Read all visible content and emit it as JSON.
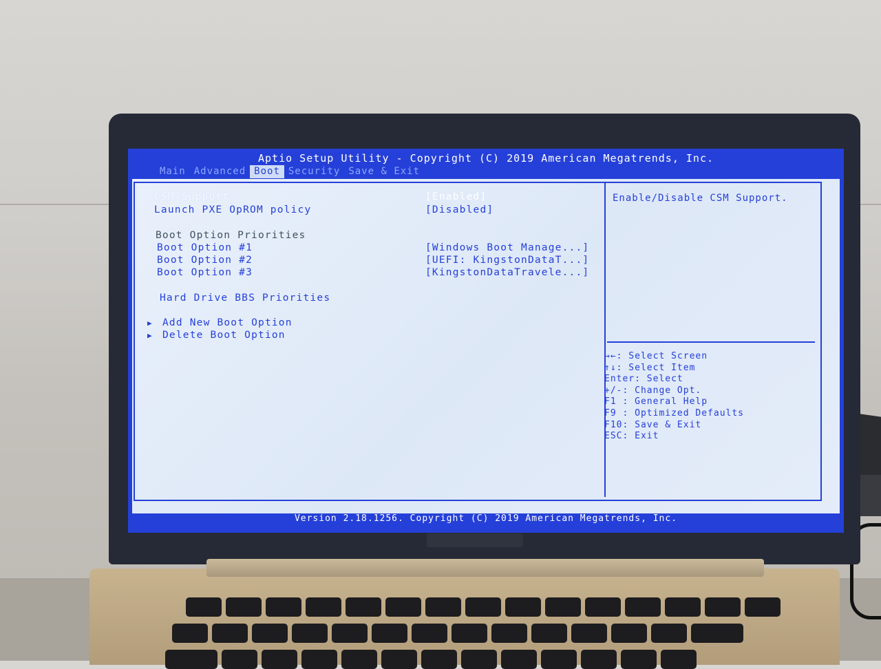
{
  "header": {
    "title": "Aptio Setup Utility - Copyright (C) 2019 American Megatrends, Inc."
  },
  "tabs": [
    {
      "label": "Main"
    },
    {
      "label": "Advanced"
    },
    {
      "label": "Boot",
      "active": true
    },
    {
      "label": "Security"
    },
    {
      "label": "Save & Exit"
    }
  ],
  "settings": {
    "csm_support": {
      "label": "CSM Support",
      "value": "[Enabled]"
    },
    "launch_pxe": {
      "label": "Launch PXE OpROM policy",
      "value": "[Disabled]"
    },
    "boot_priorities_heading": "Boot Option Priorities",
    "boot_option_1": {
      "label": "Boot Option #1",
      "value": "[Windows Boot Manage...]"
    },
    "boot_option_2": {
      "label": "Boot Option #2",
      "value": "[UEFI: KingstonDataT...]"
    },
    "boot_option_3": {
      "label": "Boot Option #3",
      "value": "[KingstonDataTravele...]"
    },
    "hdd_bbs": "Hard Drive BBS Priorities",
    "add_boot": "Add New Boot Option",
    "delete_boot": "Delete Boot Option"
  },
  "help": {
    "text": "Enable/Disable CSM Support."
  },
  "keys": [
    "→←: Select Screen",
    "↑↓: Select Item",
    "Enter: Select",
    "+/-: Change Opt.",
    "F1 : General Help",
    "F9 : Optimized Defaults",
    "F10: Save & Exit",
    "ESC: Exit"
  ],
  "footer": {
    "text": "Version 2.18.1256. Copyright (C) 2019 American Megatrends, Inc."
  },
  "colors": {
    "bios_blue": "#2540d8",
    "panel_bg": "#e4ecf9",
    "selected_text": "#ffffff"
  }
}
